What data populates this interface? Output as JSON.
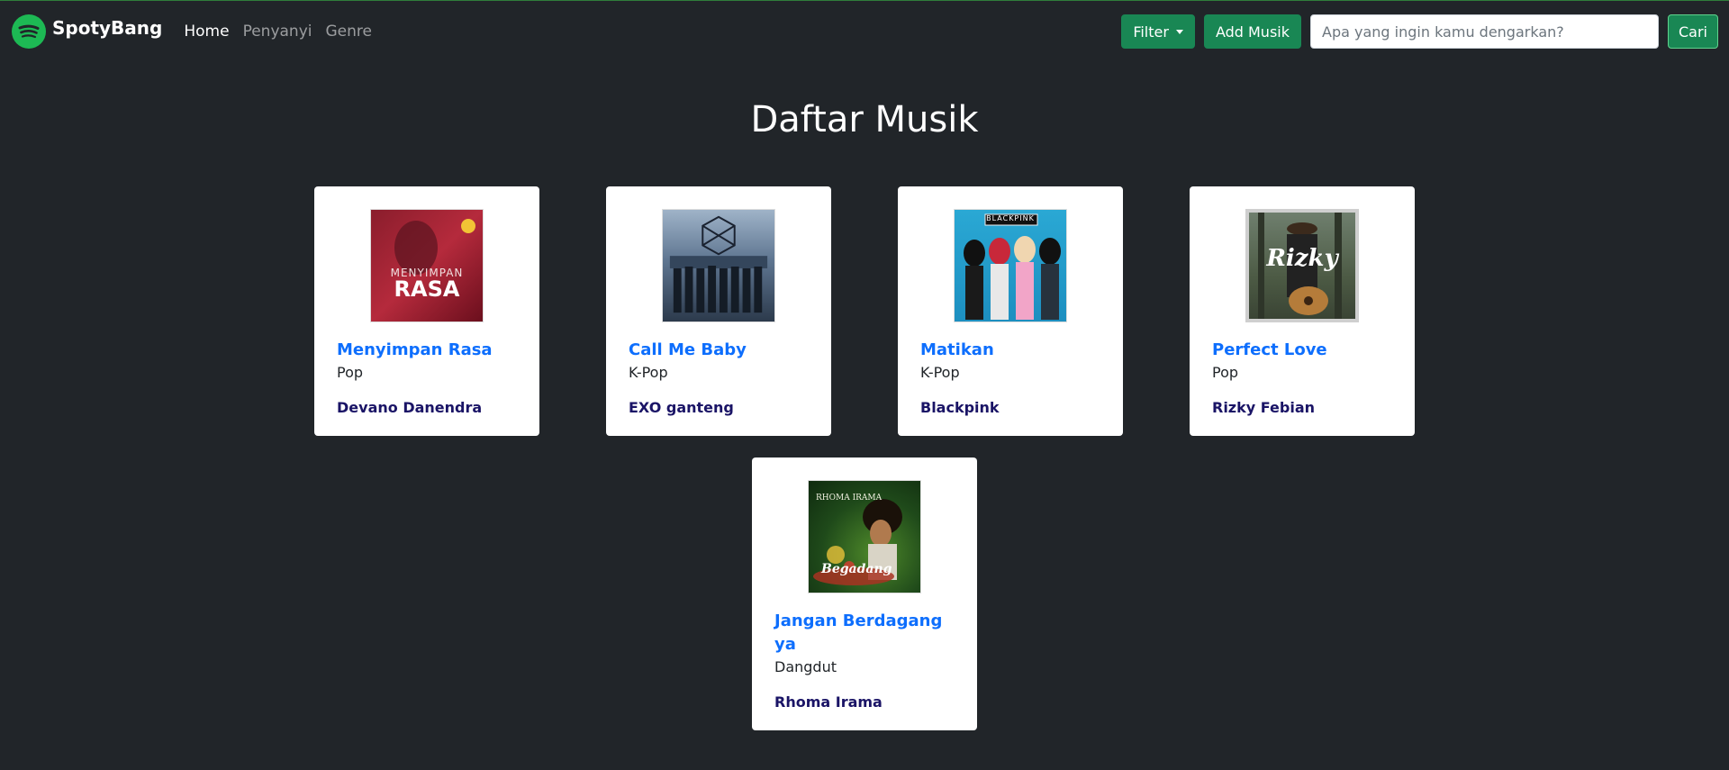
{
  "navbar": {
    "brand": "SpotyBang",
    "links": [
      {
        "label": "Home"
      },
      {
        "label": "Penyanyi"
      },
      {
        "label": "Genre"
      }
    ],
    "filter_label": "Filter",
    "add_label": "Add Musik",
    "search_placeholder": "Apa yang ingin kamu dengarkan?",
    "search_button": "Cari"
  },
  "main": {
    "title": "Daftar Musik",
    "songs": [
      {
        "title": "Menyimpan Rasa",
        "genre": "Pop",
        "singer": "Devano Danendra",
        "cover_line1": "MENYIMPAN",
        "cover_line2": "RASA"
      },
      {
        "title": "Call Me Baby",
        "genre": "K-Pop",
        "singer": "EXO ganteng"
      },
      {
        "title": "Matikan",
        "genre": "K-Pop",
        "singer": "Blackpink",
        "cover_line1": "BLACKPINK"
      },
      {
        "title": "Perfect Love",
        "genre": "Pop",
        "singer": "Rizky Febian",
        "cover_line1": "Rizky"
      },
      {
        "title": "Jangan Berdagang ya",
        "genre": "Dangdut",
        "singer": "Rhoma Irama",
        "cover_line1": "RHOMA IRAMA",
        "cover_line2": "Begadang"
      }
    ]
  },
  "colors": {
    "background": "#212529",
    "accent_green": "#198754",
    "spotify_green": "#1db954",
    "title_blue": "#0d6efd",
    "singer_navy": "#1a1466"
  },
  "icons": {
    "brand": "spotify-logo-icon",
    "filter": "caret-down-icon"
  }
}
